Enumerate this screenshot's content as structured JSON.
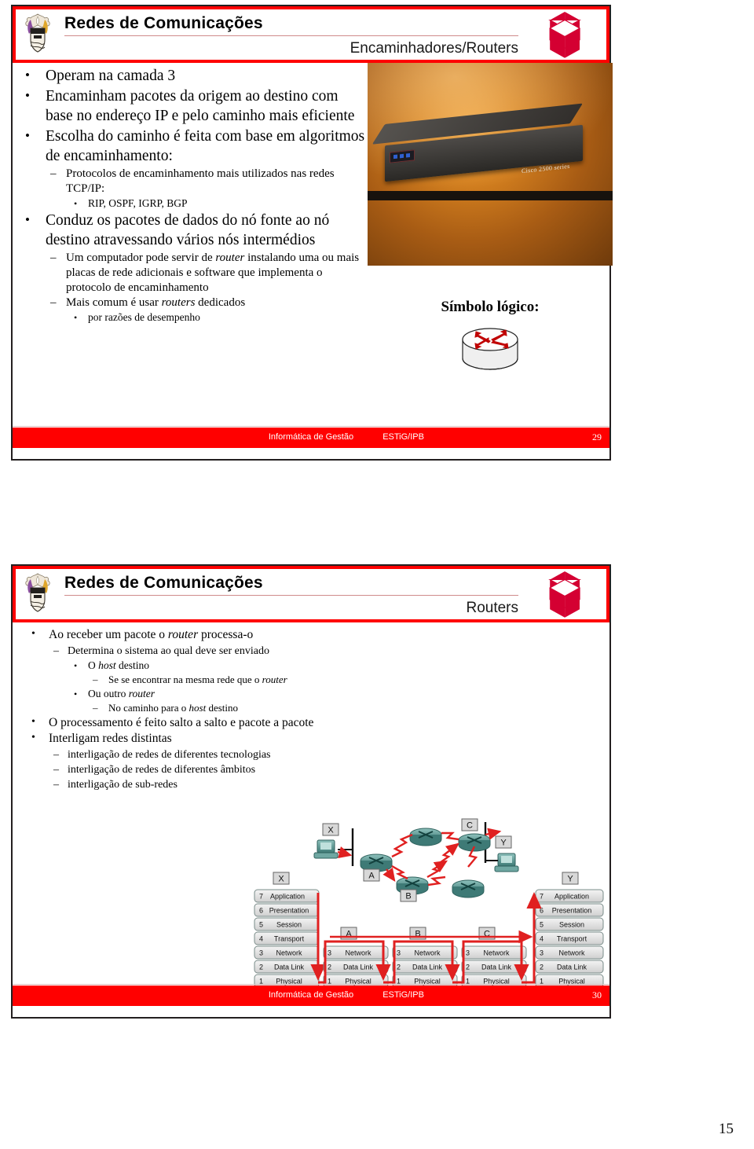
{
  "deck": {
    "title": "Redes de Comunicações",
    "course": "Informática de Gestão",
    "institution": "ESTiG/IPB",
    "handout_page": "15",
    "colors": {
      "brand_red": "#ff0000",
      "logo_red": "#d40032",
      "frame": "#231f20",
      "router_arrow_red": "#c00000",
      "diagram_red": "#e02020",
      "device_teal": "#5e9a96"
    },
    "icons": {
      "crest": "university-crest-icon",
      "cube": "ipb-cube-logo-icon",
      "router_symbol": "router-cylinder-icon",
      "workstation": "workstation-icon",
      "router_device": "router-device-icon"
    }
  },
  "slide1": {
    "subtitle": "Encaminhadores/Routers",
    "page_number": "29",
    "bullets": [
      {
        "level": 1,
        "text": "Operam na camada 3"
      },
      {
        "level": 1,
        "text": "Encaminham pacotes da origem ao destino com base no endereço IP e pelo caminho mais eficiente"
      },
      {
        "level": 1,
        "text": "Escolha do caminho é feita com base em algoritmos de encaminhamento:"
      },
      {
        "level": 2,
        "text": "Protocolos de encaminhamento mais utilizados nas redes TCP/IP:"
      },
      {
        "level": 3,
        "text": "RIP, OSPF, IGRP, BGP"
      },
      {
        "level": 1,
        "text": "Conduz os pacotes de dados do nó fonte ao nó destino atravessando vários nós intermédios"
      },
      {
        "level": 2,
        "html": "Um computador pode servir de <em>router</em> instalando uma ou mais placas de rede adicionais e software que implementa o protocolo de encaminhamento"
      },
      {
        "level": 2,
        "html": "Mais comum é usar <em>routers</em> dedicados"
      },
      {
        "level": 3,
        "text": "por razões de desempenho"
      }
    ],
    "photo": {
      "alt": "Cisco router photograph",
      "badge": "Cisco 2500 series"
    },
    "symbol_caption": "Símbolo lógico:"
  },
  "slide2": {
    "subtitle": "Routers",
    "page_number": "30",
    "bullets": [
      {
        "level": 1,
        "html": "Ao receber um pacote o <em>router</em> processa-o"
      },
      {
        "level": 2,
        "text": "Determina o sistema ao qual deve ser enviado"
      },
      {
        "level": 3,
        "html": "O <em>host</em> destino"
      },
      {
        "level": 4,
        "html": "Se se encontrar na mesma rede que o <em>router</em>"
      },
      {
        "level": 3,
        "html": "Ou outro <em>router</em>"
      },
      {
        "level": 4,
        "html": "No caminho para o <em>host</em> destino"
      },
      {
        "level": 1,
        "text": "O processamento é feito salto a salto e pacote a pacote"
      },
      {
        "level": 1,
        "text": "Interligam redes distintas"
      },
      {
        "level": 2,
        "text": "interligação de redes de diferentes tecnologias"
      },
      {
        "level": 2,
        "text": "interligação de redes de diferentes âmbitos"
      },
      {
        "level": 2,
        "text": "interligação de sub-redes"
      }
    ],
    "diagram": {
      "host_labels": [
        "X",
        "Y"
      ],
      "router_labels": [
        "A",
        "B",
        "C"
      ],
      "full_stack_labels": [
        "X",
        "Y"
      ],
      "osi_layers": [
        {
          "num": "7",
          "name": "Application"
        },
        {
          "num": "6",
          "name": "Presentation"
        },
        {
          "num": "5",
          "name": "Session"
        },
        {
          "num": "4",
          "name": "Transport"
        },
        {
          "num": "3",
          "name": "Network"
        },
        {
          "num": "2",
          "name": "Data Link"
        },
        {
          "num": "1",
          "name": "Physical"
        }
      ],
      "router_stack_layers": [
        {
          "num": "3",
          "name": "Network"
        },
        {
          "num": "2",
          "name": "Data Link"
        },
        {
          "num": "1",
          "name": "Physical"
        }
      ]
    }
  }
}
